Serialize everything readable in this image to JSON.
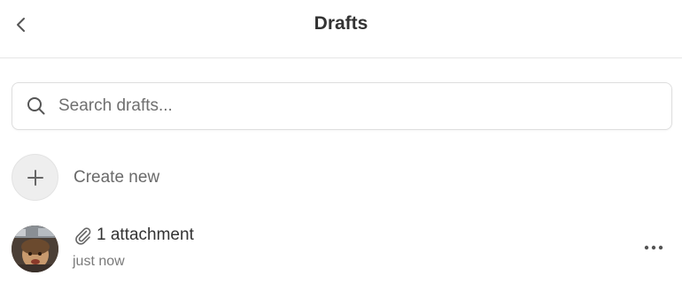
{
  "header": {
    "title": "Drafts",
    "back_icon": "chevron-left-icon"
  },
  "search": {
    "placeholder": "Search drafts...",
    "value": "",
    "icon": "search-icon"
  },
  "create": {
    "label": "Create new",
    "icon": "plus-icon"
  },
  "drafts": [
    {
      "attachment_icon": "paperclip-icon",
      "attachment_text": "1 attachment",
      "time": "just now",
      "menu_icon": "more-horizontal-icon"
    }
  ],
  "colors": {
    "divider": "#e6e6e6",
    "muted_text": "#6a6a6a",
    "create_circle_bg": "#eeeeee"
  }
}
